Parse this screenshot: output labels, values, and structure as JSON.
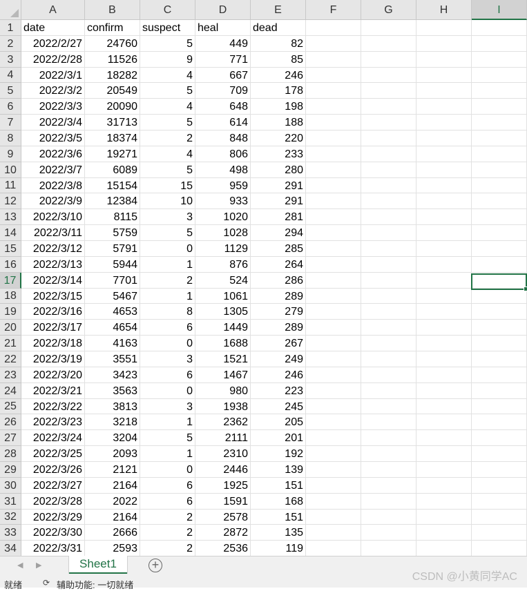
{
  "columns": [
    "A",
    "B",
    "C",
    "D",
    "E",
    "F",
    "G",
    "H",
    "I"
  ],
  "active_column": "I",
  "active_row": 17,
  "rows": [
    [
      "1",
      "date",
      "confirm",
      "suspect",
      "heal",
      "dead"
    ],
    [
      "2",
      "2022/2/27",
      "24760",
      "5",
      "449",
      "82"
    ],
    [
      "3",
      "2022/2/28",
      "11526",
      "9",
      "771",
      "85"
    ],
    [
      "4",
      "2022/3/1",
      "18282",
      "4",
      "667",
      "246"
    ],
    [
      "5",
      "2022/3/2",
      "20549",
      "5",
      "709",
      "178"
    ],
    [
      "6",
      "2022/3/3",
      "20090",
      "4",
      "648",
      "198"
    ],
    [
      "7",
      "2022/3/4",
      "31713",
      "5",
      "614",
      "188"
    ],
    [
      "8",
      "2022/3/5",
      "18374",
      "2",
      "848",
      "220"
    ],
    [
      "9",
      "2022/3/6",
      "19271",
      "4",
      "806",
      "233"
    ],
    [
      "10",
      "2022/3/7",
      "6089",
      "5",
      "498",
      "280"
    ],
    [
      "11",
      "2022/3/8",
      "15154",
      "15",
      "959",
      "291"
    ],
    [
      "12",
      "2022/3/9",
      "12384",
      "10",
      "933",
      "291"
    ],
    [
      "13",
      "2022/3/10",
      "8115",
      "3",
      "1020",
      "281"
    ],
    [
      "14",
      "2022/3/11",
      "5759",
      "5",
      "1028",
      "294"
    ],
    [
      "15",
      "2022/3/12",
      "5791",
      "0",
      "1129",
      "285"
    ],
    [
      "16",
      "2022/3/13",
      "5944",
      "1",
      "876",
      "264"
    ],
    [
      "17",
      "2022/3/14",
      "7701",
      "2",
      "524",
      "286"
    ],
    [
      "18",
      "2022/3/15",
      "5467",
      "1",
      "1061",
      "289"
    ],
    [
      "19",
      "2022/3/16",
      "4653",
      "8",
      "1305",
      "279"
    ],
    [
      "20",
      "2022/3/17",
      "4654",
      "6",
      "1449",
      "289"
    ],
    [
      "21",
      "2022/3/18",
      "4163",
      "0",
      "1688",
      "267"
    ],
    [
      "22",
      "2022/3/19",
      "3551",
      "3",
      "1521",
      "249"
    ],
    [
      "23",
      "2022/3/20",
      "3423",
      "6",
      "1467",
      "246"
    ],
    [
      "24",
      "2022/3/21",
      "3563",
      "0",
      "980",
      "223"
    ],
    [
      "25",
      "2022/3/22",
      "3813",
      "3",
      "1938",
      "245"
    ],
    [
      "26",
      "2022/3/23",
      "3218",
      "1",
      "2362",
      "205"
    ],
    [
      "27",
      "2022/3/24",
      "3204",
      "5",
      "2111",
      "201"
    ],
    [
      "28",
      "2022/3/25",
      "2093",
      "1",
      "2310",
      "192"
    ],
    [
      "29",
      "2022/3/26",
      "2121",
      "0",
      "2446",
      "139"
    ],
    [
      "30",
      "2022/3/27",
      "2164",
      "6",
      "1925",
      "151"
    ],
    [
      "31",
      "2022/3/28",
      "2022",
      "6",
      "1591",
      "168"
    ],
    [
      "32",
      "2022/3/29",
      "2164",
      "2",
      "2578",
      "151"
    ],
    [
      "33",
      "2022/3/30",
      "2666",
      "2",
      "2872",
      "135"
    ],
    [
      "34",
      "2022/3/31",
      "2593",
      "2",
      "2536",
      "119"
    ]
  ],
  "sheet_tab": "Sheet1",
  "add_sheet_symbol": "+",
  "nav_prev": "◀",
  "nav_next": "▶",
  "status": {
    "ready": "就绪",
    "accessibility": "辅助功能: 一切就绪",
    "access_icon": "⟳"
  },
  "watermark": "CSDN @小黄同学AC",
  "colors": {
    "accent": "#217346",
    "header_bg": "#e6e6e6",
    "gridline": "#e1e1e1"
  }
}
